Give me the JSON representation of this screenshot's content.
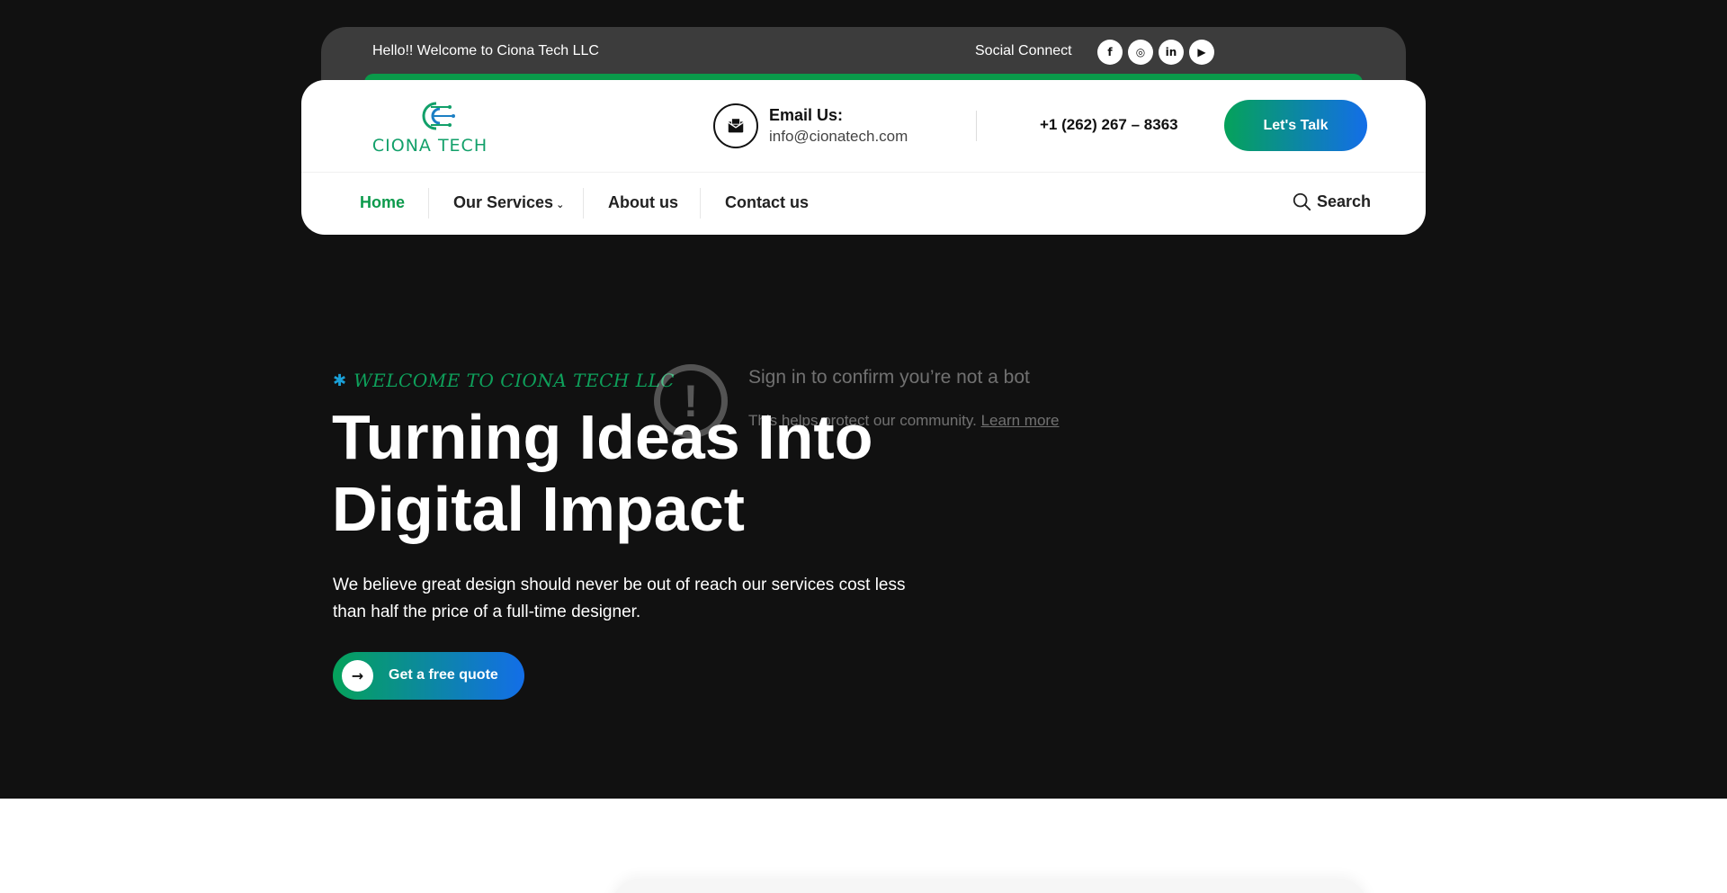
{
  "topbar": {
    "greeting": "Hello!! Welcome to Ciona Tech LLC",
    "social_label": "Social Connect",
    "social": [
      {
        "name": "facebook-icon",
        "glyph": "f"
      },
      {
        "name": "instagram-icon",
        "glyph": "◎"
      },
      {
        "name": "linkedin-icon",
        "glyph": "in"
      },
      {
        "name": "youtube-icon",
        "glyph": "▶"
      }
    ]
  },
  "header": {
    "logo_text": "CIONA TECH",
    "email_label": "Email Us:",
    "email_value": "info@cionatech.com",
    "phone": "+1 (262) 267 – 8363",
    "cta_label": "Let's Talk"
  },
  "nav": {
    "items": [
      {
        "label": "Home",
        "active": true
      },
      {
        "label": "Our Services"
      },
      {
        "label": "About us"
      },
      {
        "label": "Contact us"
      }
    ],
    "search_label": "Search"
  },
  "hero": {
    "tagline": "WELCOME TO CIONA TECH LLC",
    "title_line1": "Turning Ideas Into",
    "title_line2": "Digital Impact",
    "description": "We believe great design should never be out of reach our services cost less than half the price of a full-time designer.",
    "cta_label": "Get a free quote"
  },
  "overlay": {
    "title": "Sign in to confirm you’re not a bot",
    "text": "This helps protect our community.",
    "link": "Learn more"
  },
  "colors": {
    "brand_green": "#0c9a4c",
    "brand_blue": "#136ee8",
    "dark_bg": "#111111"
  }
}
